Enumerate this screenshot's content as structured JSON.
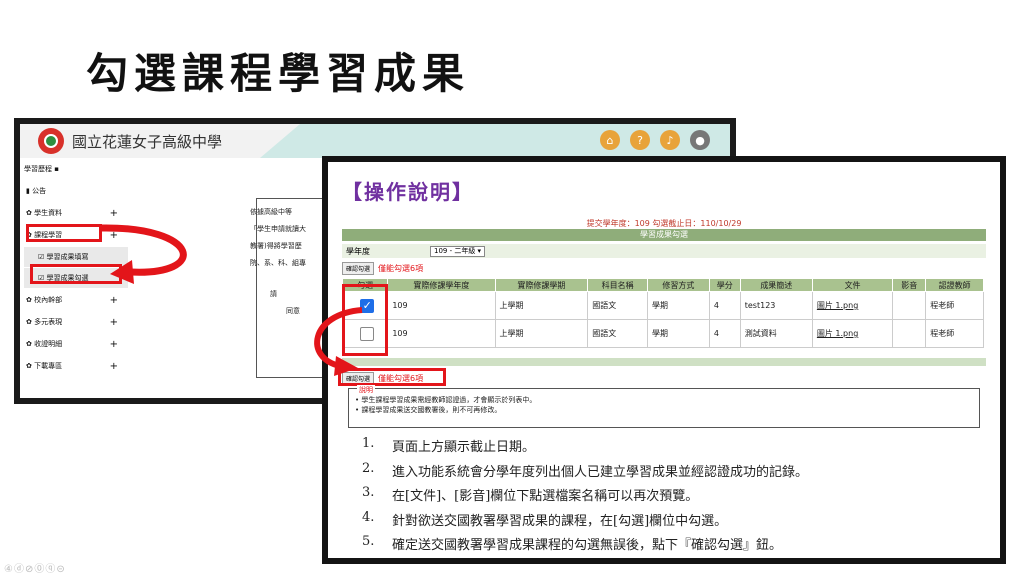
{
  "slide": {
    "title": "勾選課程學習成果",
    "nav_dots": "④ⓓ⊘⓪ⓠ⊝"
  },
  "back_screen": {
    "school_name": "國立花蓮女子高級中學",
    "header_icons": [
      "home-icon",
      "help-icon",
      "sound-icon",
      "user-icon"
    ],
    "sidebar": {
      "title": "學習歷程 ▪",
      "items": [
        {
          "label": "▮ 公告",
          "plus": ""
        },
        {
          "label": "✿ 學生資料",
          "plus": "+"
        },
        {
          "label": "✿ 課程學習",
          "plus": "+"
        },
        {
          "label": "☑ 學習成果填寫",
          "plus": ""
        },
        {
          "label": "☑ 學習成果勾選",
          "plus": ""
        },
        {
          "label": "✿ 校內幹部",
          "plus": "+"
        },
        {
          "label": "✿ 多元表現",
          "plus": "+"
        },
        {
          "label": "✿ 收證明細",
          "plus": "+"
        },
        {
          "label": "✿ 下載專區",
          "plus": "+"
        }
      ]
    },
    "content_lines": [
      "依據高級中等",
      "「學生申請就讀大",
      "教署)得將學習歷",
      "院、系、科、組專",
      "請",
      "同意"
    ]
  },
  "front_screen": {
    "op_title": "【操作說明】",
    "deadline": "提交學年度：109 勾選截止日：110/10/29",
    "table_caption": "學習成果勾選",
    "year_label": "學年度",
    "year_value": "109 - 二年級 ▾",
    "confirm_button": "確認勾選",
    "limit_text": "僅能勾選6項",
    "columns": [
      "勾選",
      "實際修課學年度",
      "實際修課學期",
      "科目名稱",
      "修習方式",
      "學分",
      "成果簡述",
      "文件",
      "影音",
      "認證教師"
    ],
    "rows": [
      {
        "checked": true,
        "year": "109",
        "term": "上學期",
        "subject": "國語文",
        "mode": "學期",
        "credit": "4",
        "summary": "test123",
        "file": "圖片 1.png",
        "media": "",
        "teacher": "程老師"
      },
      {
        "checked": false,
        "year": "109",
        "term": "上學期",
        "subject": "國語文",
        "mode": "學期",
        "credit": "4",
        "summary": "測試資料",
        "file": "圖片 1.png",
        "media": "",
        "teacher": "程老師"
      }
    ],
    "notes_label": "說明",
    "notes": [
      "• 學生課程學習成果需經教師認證過，才會顯示於列表中。",
      "• 課程學習成果送交國教署後，則不可再修改。"
    ],
    "steps": [
      {
        "num": "1.",
        "text": "頁面上方顯示截止日期。"
      },
      {
        "num": "2.",
        "text": "進入功能系統會分學年度列出個人已建立學習成果並經認證成功的記錄。"
      },
      {
        "num": "3.",
        "text": "在[文件]、[影音]欄位下點選檔案名稱可以再次預覽。"
      },
      {
        "num": "4.",
        "text": "針對欲送交國教署學習成果的課程，在[勾選]欄位中勾選。"
      },
      {
        "num": "5.",
        "text": "確定送交國教署學習成果課程的勾選無誤後，點下『確認勾選』鈕。"
      }
    ]
  },
  "colors": {
    "accent_red": "#e3151a",
    "purple": "#7030a0",
    "table_green": "#a9c28f",
    "check_blue": "#1e6ee8"
  }
}
